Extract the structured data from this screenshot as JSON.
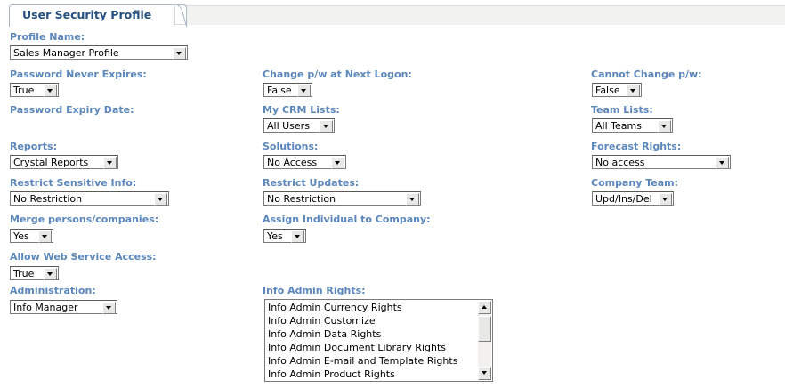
{
  "tab": {
    "title": "User Security Profile"
  },
  "profile": {
    "label": "Profile Name:",
    "value": "Sales Manager Profile"
  },
  "row1": {
    "pw_never_expires": {
      "label": "Password Never Expires:",
      "value": "True"
    },
    "change_pw_next_logon": {
      "label": "Change p/w at Next Logon:",
      "value": "False"
    },
    "cannot_change_pw": {
      "label": "Cannot Change p/w:",
      "value": "False"
    }
  },
  "row2": {
    "pw_expiry_date": {
      "label": "Password Expiry Date:"
    },
    "my_crm_lists": {
      "label": "My CRM Lists:",
      "value": "All Users"
    },
    "team_lists": {
      "label": "Team Lists:",
      "value": "All Teams"
    }
  },
  "row3": {
    "reports": {
      "label": "Reports:",
      "value": "Crystal Reports"
    },
    "solutions": {
      "label": "Solutions:",
      "value": "No Access"
    },
    "forecast_rights": {
      "label": "Forecast Rights:",
      "value": "No access"
    }
  },
  "row4": {
    "restrict_sensitive": {
      "label": "Restrict Sensitive Info:",
      "value": "No Restriction"
    },
    "restrict_updates": {
      "label": "Restrict Updates:",
      "value": "No Restriction"
    },
    "company_team": {
      "label": "Company Team:",
      "value": "Upd/Ins/Del"
    }
  },
  "row5": {
    "merge": {
      "label": "Merge persons/companies:",
      "value": "Yes"
    },
    "assign_individual": {
      "label": "Assign Individual to Company:",
      "value": "Yes"
    }
  },
  "row6": {
    "web_service": {
      "label": "Allow Web Service Access:",
      "value": "True"
    }
  },
  "row7": {
    "administration": {
      "label": "Administration:",
      "value": "Info Manager"
    },
    "info_admin_rights": {
      "label": "Info Admin Rights:",
      "items": [
        "Info Admin Currency Rights",
        "Info Admin Customize",
        "Info Admin Data Rights",
        "Info Admin Document Library Rights",
        "Info Admin E-mail and Template Rights",
        "Info Admin Product Rights"
      ]
    }
  },
  "icons": {
    "dropdown": "chevron-down-icon",
    "scroll_up": "arrow-up-icon",
    "scroll_down": "arrow-down-icon"
  }
}
